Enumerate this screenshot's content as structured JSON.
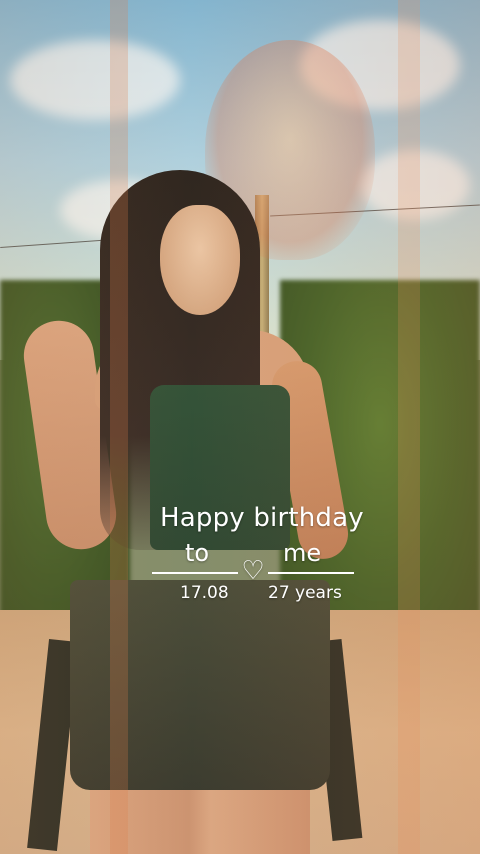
{
  "greeting": {
    "line1": "Happy birthday",
    "to": "to",
    "me": "me",
    "heart": "♡",
    "date": "17.08",
    "age": "27 years"
  },
  "icons": {
    "heart": "heart-outline-icon"
  },
  "colors": {
    "text": "#ffffff",
    "overlay_tint": "#e0965a"
  }
}
